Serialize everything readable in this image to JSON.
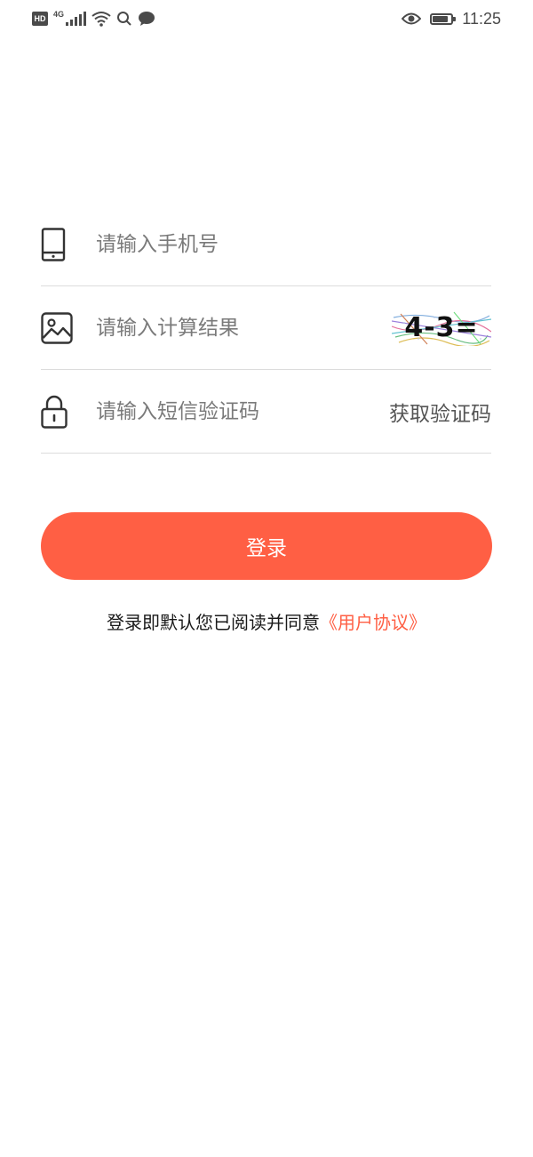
{
  "status_bar": {
    "hd_badge": "HD",
    "network_type": "4G",
    "time": "11:25",
    "battery_level": 0.85,
    "icons": [
      "hd-icon",
      "signal-icon",
      "wifi-icon",
      "search-icon",
      "message-icon",
      "eye-icon",
      "battery-icon"
    ]
  },
  "form": {
    "phone": {
      "icon": "phone-icon",
      "placeholder": "请输入手机号",
      "value": ""
    },
    "captcha": {
      "icon": "image-icon",
      "placeholder": "请输入计算结果",
      "value": "",
      "captcha_text": "4-3="
    },
    "sms_code": {
      "icon": "lock-icon",
      "placeholder": "请输入短信验证码",
      "value": "",
      "get_code_label": "获取验证码"
    }
  },
  "login_button": {
    "label": "登录"
  },
  "agreement": {
    "prefix": "登录即默认您已阅读并同意",
    "link": "《用户协议》"
  },
  "colors": {
    "accent": "#ff5f44",
    "divider": "#dcdcdc",
    "placeholder": "#7a7a7a",
    "icon": "#333333"
  }
}
